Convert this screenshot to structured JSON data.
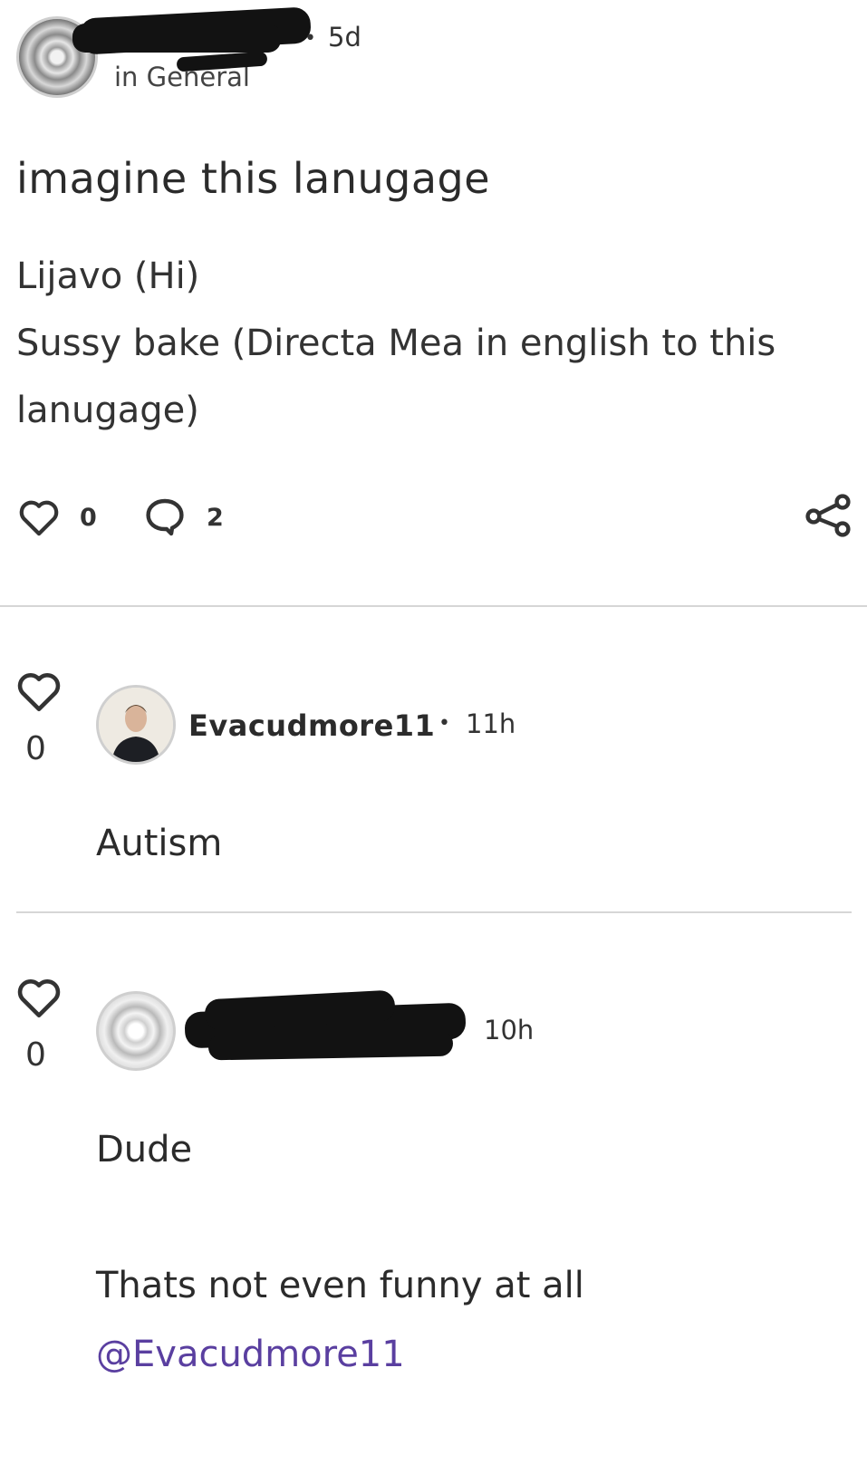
{
  "post": {
    "time": "5d",
    "category_prefix": "in General",
    "title": "imagine this lanugage",
    "body_line_1": "Lijavo (Hi)",
    "body_line_2": "Sussy bake (Directa Mea in english to this",
    "body_line_3": "lanugage)",
    "likes": "0",
    "comments": "2"
  },
  "comments": [
    {
      "author": "Evacudmore11",
      "time": "11h",
      "votes": "0",
      "text": "Autism"
    },
    {
      "time": "10h",
      "votes": "0",
      "text_1": "Dude",
      "text_2": "Thats not even funny at all",
      "mention": "@Evacudmore11"
    }
  ],
  "icons": {
    "like": "heart-icon",
    "comment": "speech-bubble-icon",
    "share": "share-icon",
    "vote": "heart-icon"
  },
  "colors": {
    "mention": "#5a3fa0",
    "divider": "#d6d6d6",
    "text": "#2b2b2b"
  }
}
